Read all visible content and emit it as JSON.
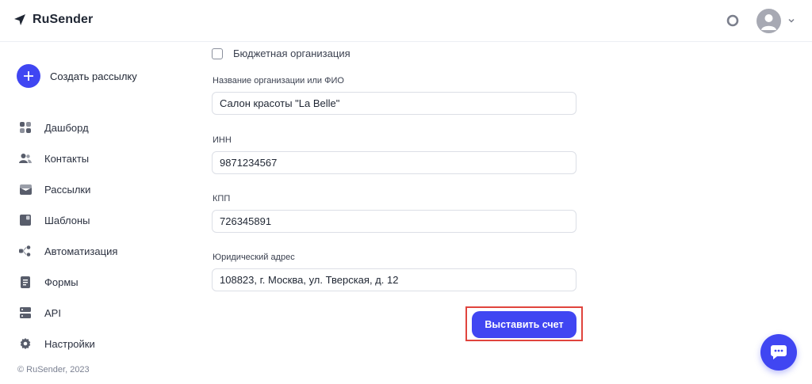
{
  "app": {
    "brand": "RuSender"
  },
  "colors": {
    "accent": "#4046f2",
    "highlight": "#e0443d"
  },
  "header": {
    "help_icon": "help-ring-icon",
    "avatar_icon": "user-avatar-icon",
    "menu_icon": "chevron-down-icon"
  },
  "sidebar": {
    "create_label": "Создать рассылку",
    "items": [
      {
        "label": "Дашборд",
        "icon": "dashboard-icon"
      },
      {
        "label": "Контакты",
        "icon": "contacts-icon"
      },
      {
        "label": "Рассылки",
        "icon": "mailings-icon"
      },
      {
        "label": "Шаблоны",
        "icon": "templates-icon"
      },
      {
        "label": "Автоматизация",
        "icon": "automation-icon"
      },
      {
        "label": "Формы",
        "icon": "forms-icon"
      },
      {
        "label": "API",
        "icon": "api-icon"
      },
      {
        "label": "Настройки",
        "icon": "settings-icon"
      }
    ],
    "copyright": "© RuSender, 2023"
  },
  "form": {
    "budget_checkbox_label": "Бюджетная организация",
    "budget_checked": false,
    "org_name_label": "Название организации или ФИО",
    "org_name_value": "Салон красоты \"La Belle\"",
    "inn_label": "ИНН",
    "inn_value": "9871234567",
    "kpp_label": "КПП",
    "kpp_value": "726345891",
    "address_label": "Юридический адрес",
    "address_value": "108823, г. Москва, ул. Тверская, д. 12",
    "submit_label": "Выставить счет"
  }
}
